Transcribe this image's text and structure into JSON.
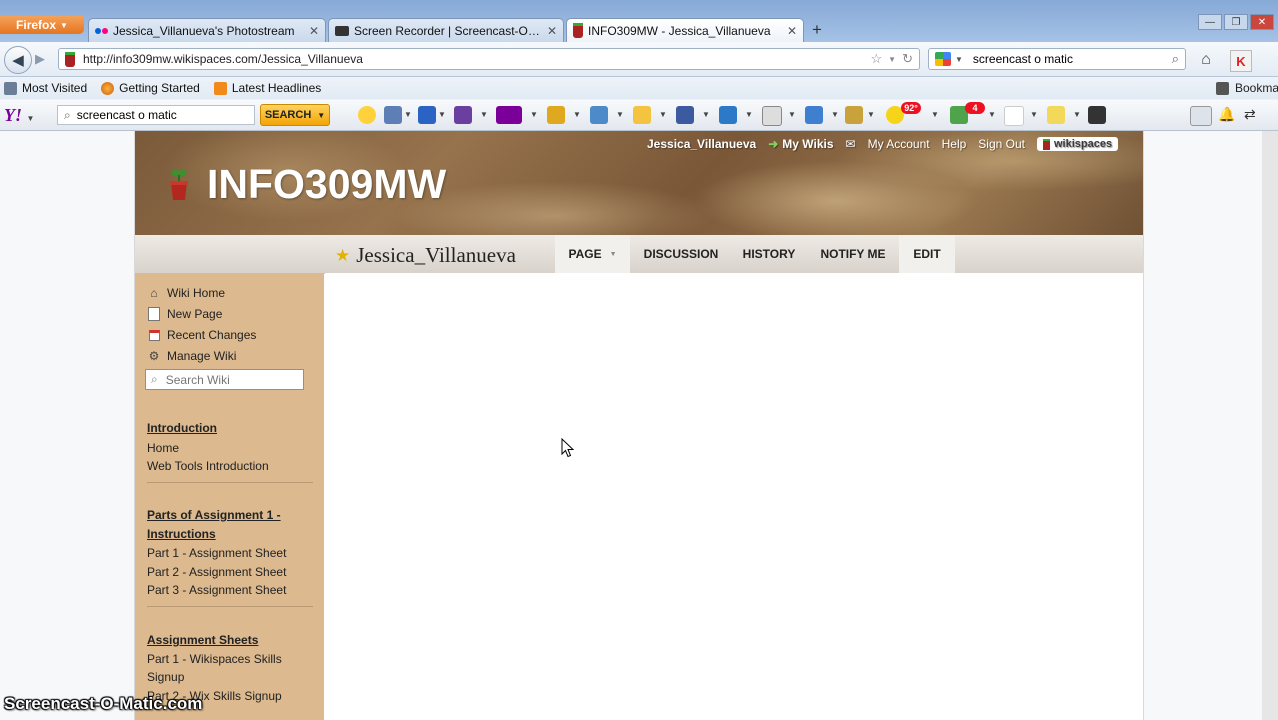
{
  "browser": {
    "menu_button": "Firefox",
    "tabs": [
      {
        "label": "Jessica_Villanueva's Photostream",
        "active": false
      },
      {
        "label": "Screen Recorder | Screencast-O-Mati...",
        "active": false
      },
      {
        "label": "INFO309MW - Jessica_Villanueva",
        "active": true
      }
    ],
    "new_tab": "+",
    "url": "http://info309mw.wikispaces.com/Jessica_Villanueva",
    "search_value": "screencast o matic",
    "bookmarks": [
      "Most Visited",
      "Getting Started",
      "Latest Headlines"
    ],
    "bookmarks_menu": "Bookmarks"
  },
  "yahoo_toolbar": {
    "logo": "Y!",
    "search_value": "screencast o matic",
    "search_button": "SEARCH",
    "weather_badge": "92°",
    "mail_badge": "4"
  },
  "wiki": {
    "site_title": "INFO309MW",
    "user_links": {
      "username": "Jessica_Villanueva",
      "my_wikis": "My Wikis",
      "my_account": "My Account",
      "help": "Help",
      "sign_out": "Sign Out",
      "brand": "wikispaces"
    },
    "page_name": "Jessica_Villanueva",
    "page_tabs": {
      "page": "PAGE",
      "discussion": "DISCUSSION",
      "history": "HISTORY",
      "notify": "NOTIFY ME",
      "edit": "EDIT"
    },
    "nav": {
      "home": "Wiki Home",
      "new_page": "New Page",
      "recent": "Recent Changes",
      "manage": "Manage Wiki",
      "search_placeholder": "Search Wiki"
    },
    "sections": [
      {
        "heading": "Introduction",
        "items": [
          "Home",
          "Web Tools Introduction"
        ]
      },
      {
        "heading": "Parts of Assignment 1 - Instructions",
        "items": [
          "Part 1 - Assignment Sheet",
          "Part 2 - Assignment Sheet",
          "Part 3 - Assignment Sheet"
        ]
      },
      {
        "heading": "Assignment Sheets",
        "items": [
          "Part 1 - Wikispaces Skills Signup",
          "Part 2 - Wix Skills Signup"
        ]
      }
    ]
  },
  "watermark": "Screencast-O-Matic.com",
  "colors": {
    "sidebar": "#dcb98e",
    "tab_strip": "#a6c2e6",
    "search_button": "#f2a406"
  }
}
